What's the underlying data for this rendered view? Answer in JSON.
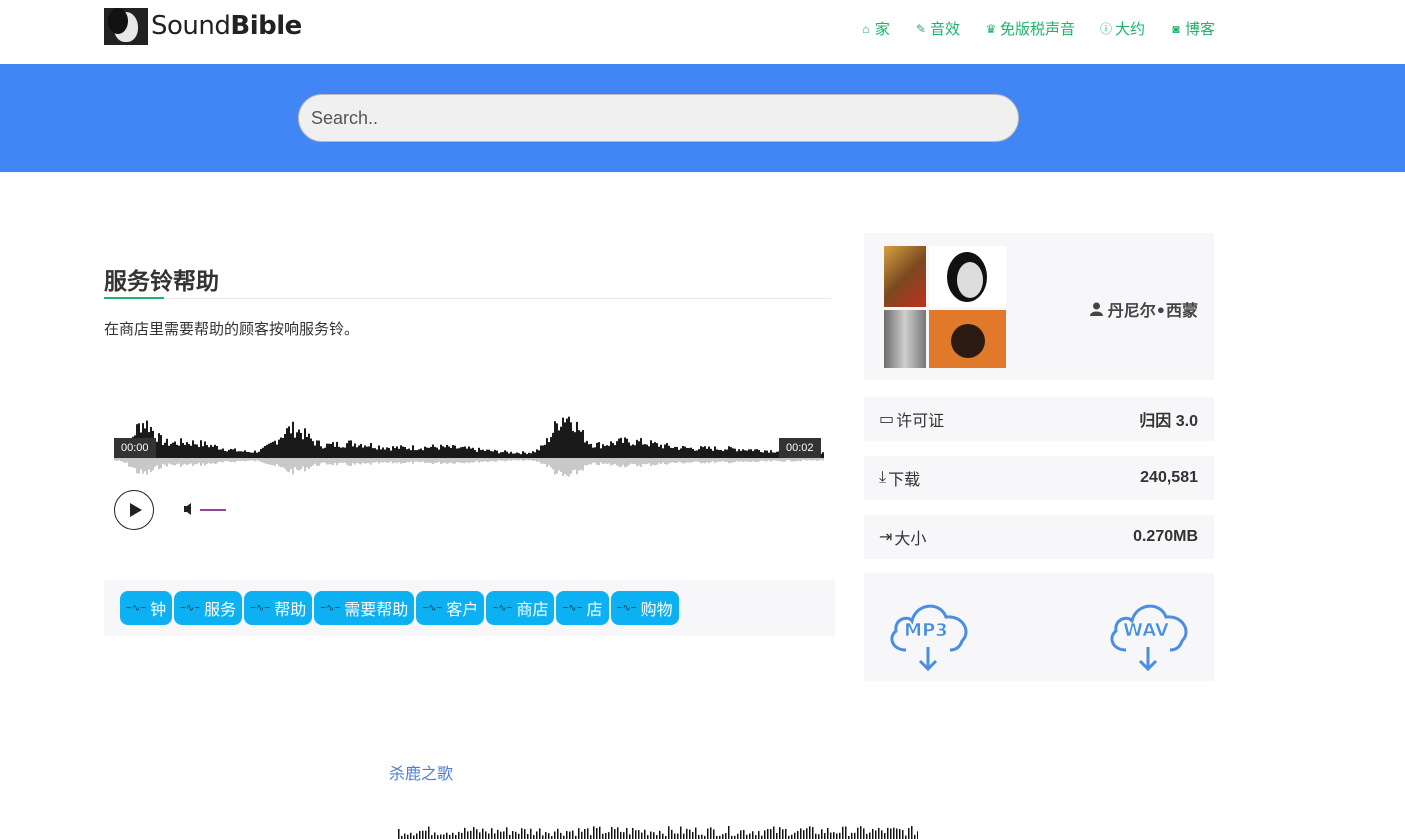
{
  "header": {
    "logo": {
      "light": "Sound",
      "bold": "Bible"
    },
    "nav": [
      {
        "label": "家",
        "icon": "home-icon",
        "glyph": "⌂"
      },
      {
        "label": "音效",
        "icon": "sound-effects-icon",
        "glyph": "✎"
      },
      {
        "label": "免版税声音",
        "icon": "crown-icon",
        "glyph": "♛"
      },
      {
        "label": "大约",
        "icon": "info-icon",
        "glyph": "ⓘ"
      },
      {
        "label": "博客",
        "icon": "blog-icon",
        "glyph": "◙"
      }
    ]
  },
  "search": {
    "placeholder": "Search.."
  },
  "sound": {
    "title": "服务铃帮助",
    "description": "在商店里需要帮助的顾客按响服务铃。",
    "time_start": "00:00",
    "time_end": "00:02"
  },
  "tags": [
    "钟",
    "服务",
    "帮助",
    "需要帮助",
    "客户",
    "商店",
    "店",
    "购物"
  ],
  "sidebar": {
    "author": "丹尼尔•西蒙",
    "license_label": "许可证",
    "license_value": "归因 3.0",
    "downloads_label": "下载",
    "downloads_value": "240,581",
    "size_label": "大小",
    "size_value": "0.270MB",
    "download_buttons": [
      "MP3",
      "WAV"
    ]
  },
  "next": {
    "title": "杀鹿之歌"
  },
  "colors": {
    "accent": "#1db36b",
    "band": "#4285f4",
    "tag": "#0db1f2",
    "download": "#4a8ee0"
  }
}
